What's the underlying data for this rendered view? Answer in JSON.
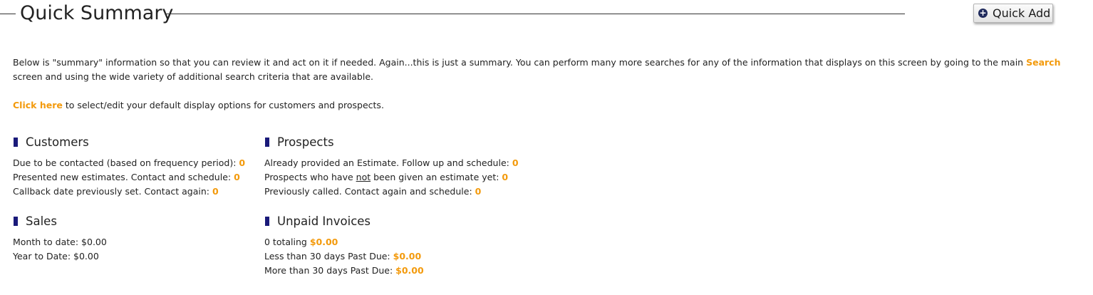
{
  "header": {
    "title": "Quick Summary",
    "quick_add_label": "Quick Add"
  },
  "intro": {
    "text_before_link": "Below is \"summary\" information so that you can review it and act on it if needed. Again...this is just a summary. You can perform many more searches for any of the information that displays on this screen by going to the main ",
    "search_link": "Search",
    "text_after_link": " screen and using the wide variety of additional search criteria that are available.",
    "click_here": "Click here",
    "click_here_suffix": " to select/edit your default display options for customers and prospects."
  },
  "customers": {
    "title": "Customers",
    "rows": [
      {
        "label": "Due to be contacted (based on frequency period): ",
        "value": "0"
      },
      {
        "label": "Presented new estimates. Contact and schedule: ",
        "value": "0"
      },
      {
        "label": "Callback date previously set. Contact again: ",
        "value": "0"
      }
    ]
  },
  "prospects": {
    "title": "Prospects",
    "rows": [
      {
        "label": "Already provided an Estimate. Follow up and schedule: ",
        "value": "0"
      },
      {
        "label_pre": "Prospects who have ",
        "label_u": "not",
        "label_post": " been given an estimate yet: ",
        "value": "0"
      },
      {
        "label": "Previously called. Contact again and schedule: ",
        "value": "0"
      }
    ]
  },
  "sales": {
    "title": "Sales",
    "rows": [
      {
        "label": "Month to date: $0.00"
      },
      {
        "label": "Year to Date: $0.00"
      }
    ]
  },
  "unpaid": {
    "title": "Unpaid Invoices",
    "rows": [
      {
        "label": "0 totaling ",
        "value": "$0.00"
      },
      {
        "label": "Less than 30 days Past Due: ",
        "value": "$0.00"
      },
      {
        "label": "More than 30 days Past Due: ",
        "value": "$0.00"
      }
    ]
  },
  "colors": {
    "accent_orange": "#f39a0c",
    "marker_navy": "#1a1a7a"
  }
}
